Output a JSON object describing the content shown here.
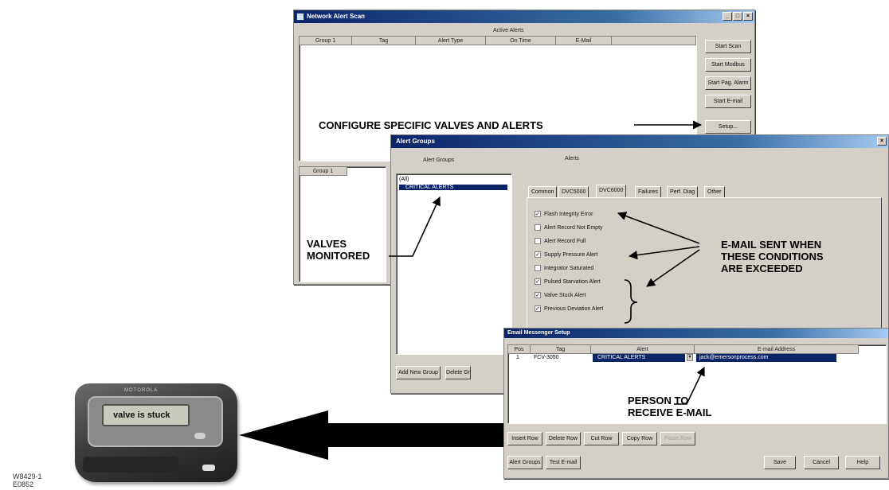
{
  "network_window": {
    "title": "Network Alert Scan",
    "caption": "Active Alerts",
    "columns": [
      "Group 1",
      "Tag",
      "Alert Type",
      "On Time",
      "E-Mail"
    ],
    "lower_column": "Group 1",
    "buttons": [
      "Start Scan",
      "Start Modbus",
      "Start Pag. Alarm",
      "Start E-mail",
      "Setup..."
    ]
  },
  "alert_groups_window": {
    "title": "Alert Groups",
    "groups_label": "Alert Groups",
    "alerts_label": "Alerts",
    "groups": [
      "(All)",
      "CRITICAL ALERTS"
    ],
    "tabs": [
      "Common",
      "DVC5000",
      "DVC6000",
      "Failures",
      "Perf. Diag",
      "Other"
    ],
    "active_tab": "DVC6000",
    "checkboxes": [
      {
        "label": "Flash Integrity Error",
        "checked": true
      },
      {
        "label": "Alert Record Not Empty",
        "checked": false
      },
      {
        "label": "Alert Record Full",
        "checked": false
      },
      {
        "label": "Supply Pressure Alert",
        "checked": true
      },
      {
        "label": "Integrator Saturated",
        "checked": false
      },
      {
        "label": "Pulsed Starvation Alert",
        "checked": true
      },
      {
        "label": "Valve Stuck Alert",
        "checked": true
      },
      {
        "label": "Previous Deviation Alert",
        "checked": true
      }
    ],
    "buttons": [
      "Add New Group",
      "Delete Gr"
    ]
  },
  "email_window": {
    "title": "Email Messenger Setup",
    "columns": [
      "Pos",
      "Tag",
      "Alert",
      "E-mail Address"
    ],
    "row": {
      "pos": "1",
      "tag": "FCV-3050",
      "alert": "CRITICAL ALERTS",
      "email": "jack@emersonprocess.com"
    },
    "buttons_row1": [
      "Insert Row",
      "Delete Row",
      "Cut Row",
      "Copy Row",
      "Paste Row"
    ],
    "buttons_row2": [
      "Alert Groups",
      "Test E-mail"
    ],
    "buttons_right": [
      "Save",
      "Cancel",
      "Help"
    ]
  },
  "pager": {
    "screen_text": "valve is stuck",
    "brand": "MOTOROLA"
  },
  "callouts": {
    "configure": "CONFIGURE SPECIFIC VALVES AND ALERTS",
    "valves_1": "VALVES",
    "valves_2": "MONITORED",
    "email_1": "E-MAIL SENT WHEN",
    "email_2": "THESE CONDITIONS",
    "email_3": "ARE EXCEEDED",
    "person_1": "PERSON TO",
    "person_2": "RECEIVE E-MAIL"
  },
  "figure_id": {
    "line1": "W8429-1",
    "line2": "E0852"
  },
  "colors": {
    "titlebar": "#0a246a",
    "dialog": "#d4d0c8",
    "selection": "#0a246a"
  }
}
